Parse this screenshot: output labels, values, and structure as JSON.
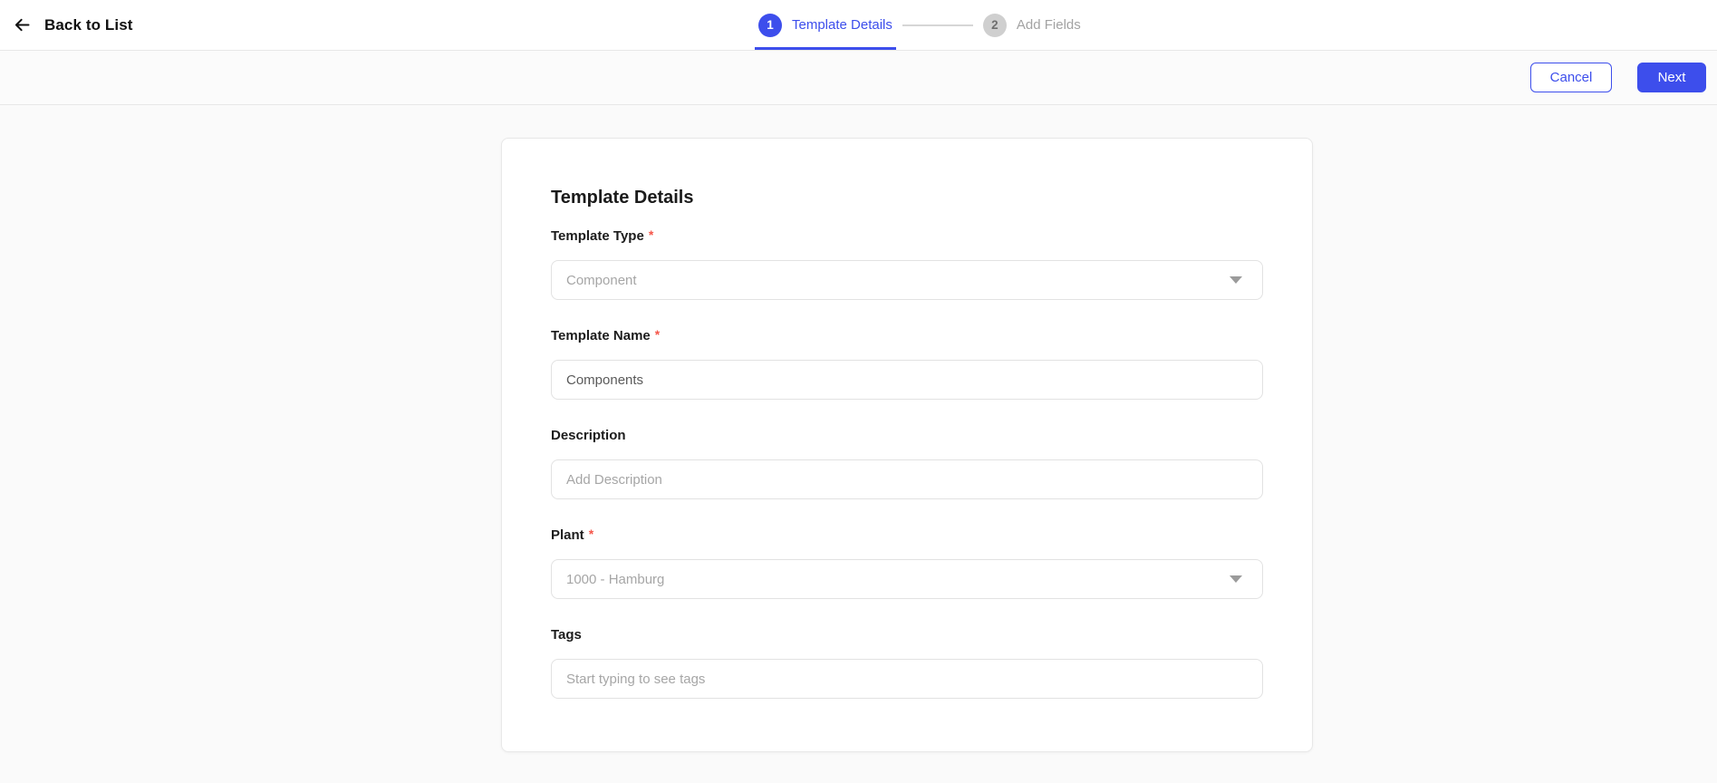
{
  "header": {
    "back_label": "Back to List"
  },
  "stepper": {
    "steps": [
      {
        "number": "1",
        "label": "Template Details",
        "state": "active"
      },
      {
        "number": "2",
        "label": "Add Fields",
        "state": "inactive"
      }
    ]
  },
  "toolbar": {
    "cancel_label": "Cancel",
    "next_label": "Next"
  },
  "form": {
    "title": "Template Details",
    "required_marker": "*",
    "fields": [
      {
        "label": "Template Type",
        "required": true,
        "control": "select",
        "value": "Component"
      },
      {
        "label": "Template Name",
        "required": true,
        "control": "input",
        "value": "Components",
        "placeholder": ""
      },
      {
        "label": "Description",
        "required": false,
        "control": "input",
        "value": "",
        "placeholder": "Add Description"
      },
      {
        "label": "Plant",
        "required": true,
        "control": "select",
        "value": "1000 - Hamburg"
      },
      {
        "label": "Tags",
        "required": false,
        "control": "input",
        "value": "",
        "placeholder": "Start typing to see tags"
      }
    ]
  },
  "icons": {
    "back": "arrow-left-icon",
    "select_caret": "caret-down-icon"
  },
  "colors": {
    "primary": "#3d4eec",
    "required_asterisk": "#f5564a"
  }
}
